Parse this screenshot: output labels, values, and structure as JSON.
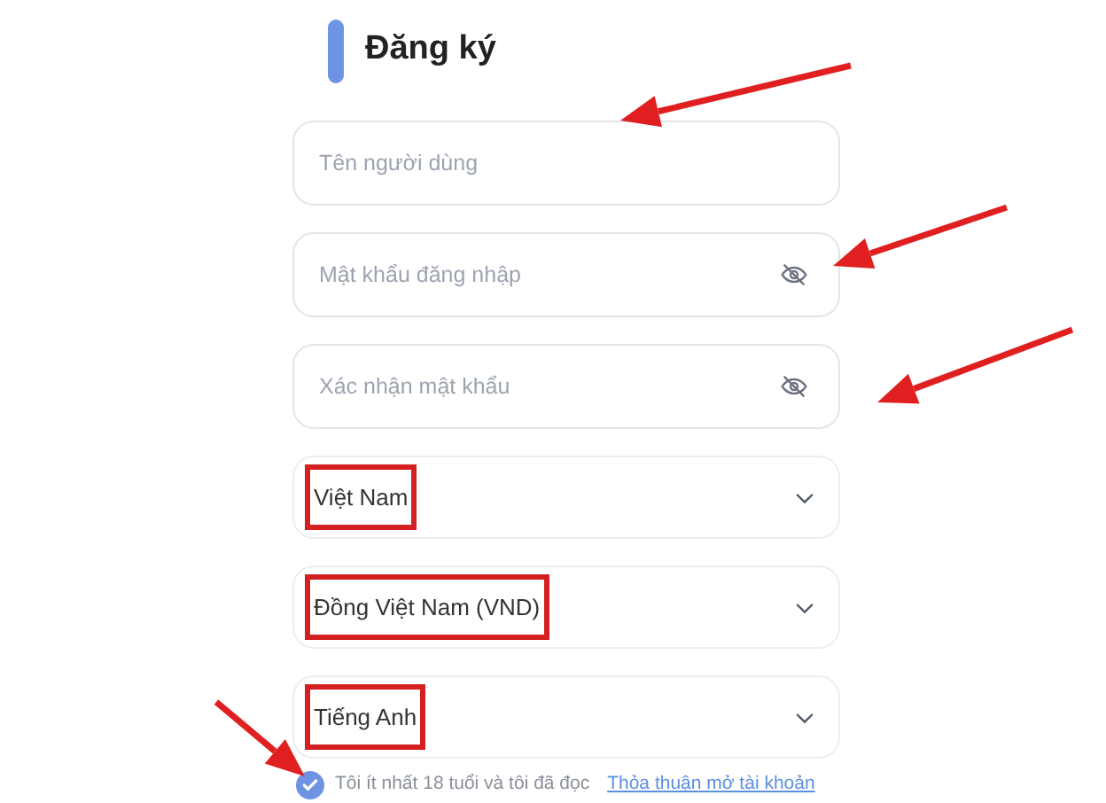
{
  "title": "Đăng ký",
  "fields": [
    {
      "kind": "text",
      "placeholder": "Tên người dùng"
    },
    {
      "kind": "password",
      "placeholder": "Mật khẩu đăng nhập"
    },
    {
      "kind": "password",
      "placeholder": "Xác nhận mật khẩu"
    }
  ],
  "selects": [
    {
      "value": "Việt Nam",
      "highlighted": true
    },
    {
      "value": "Đồng Việt Nam (VND)",
      "highlighted": true
    },
    {
      "value": "Tiếng Anh",
      "highlighted": true
    }
  ],
  "agreement": {
    "checked": true,
    "text": "Tôi ít nhất 18 tuổi và tôi đã đọc",
    "link": "Thỏa thuận mở tài khoản"
  }
}
